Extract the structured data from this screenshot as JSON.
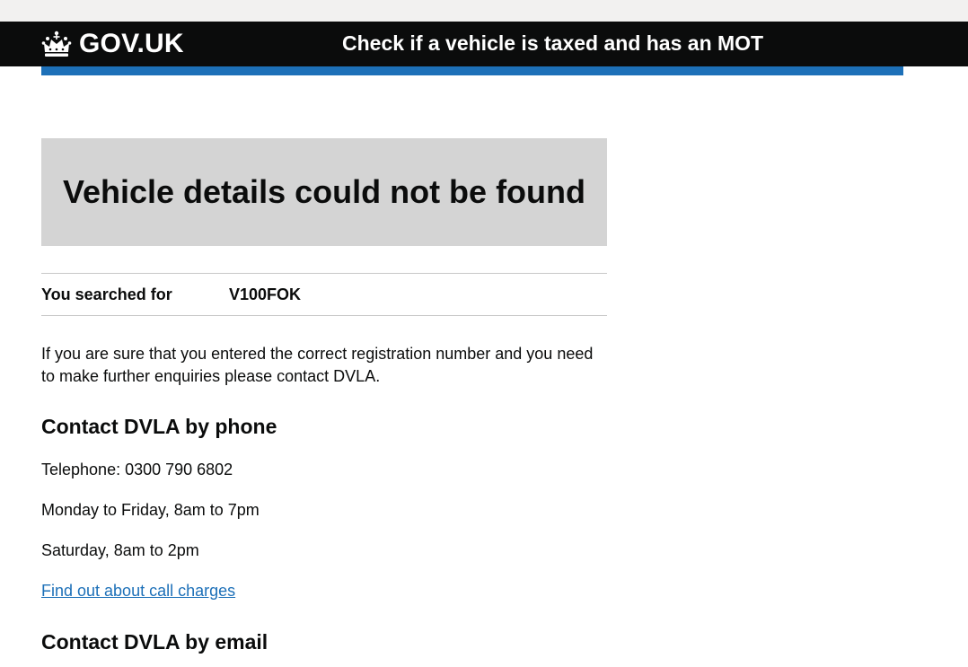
{
  "header": {
    "logo_text": "GOV.UK",
    "service_name": "Check if a vehicle is taxed and has an MOT"
  },
  "panel": {
    "title": "Vehicle details could not be found"
  },
  "summary": {
    "key": "You searched for",
    "value": "V100FOK"
  },
  "intro": "If you are sure that you entered the correct registration number and you need to make further enquiries please contact DVLA.",
  "phone_section": {
    "heading": "Contact DVLA by phone",
    "telephone": "Telephone: 0300 790 6802",
    "weekday_hours": "Monday to Friday, 8am to 7pm",
    "saturday_hours": "Saturday, 8am to 2pm",
    "call_charges_link": "Find out about call charges"
  },
  "email_section": {
    "heading": "Contact DVLA by email"
  },
  "colors": {
    "header_bg": "#0b0c0c",
    "accent_blue": "#1d70b8",
    "panel_bg": "#d4d4d4",
    "link": "#1d70b8"
  },
  "icons": {
    "logo": "crown-icon"
  }
}
